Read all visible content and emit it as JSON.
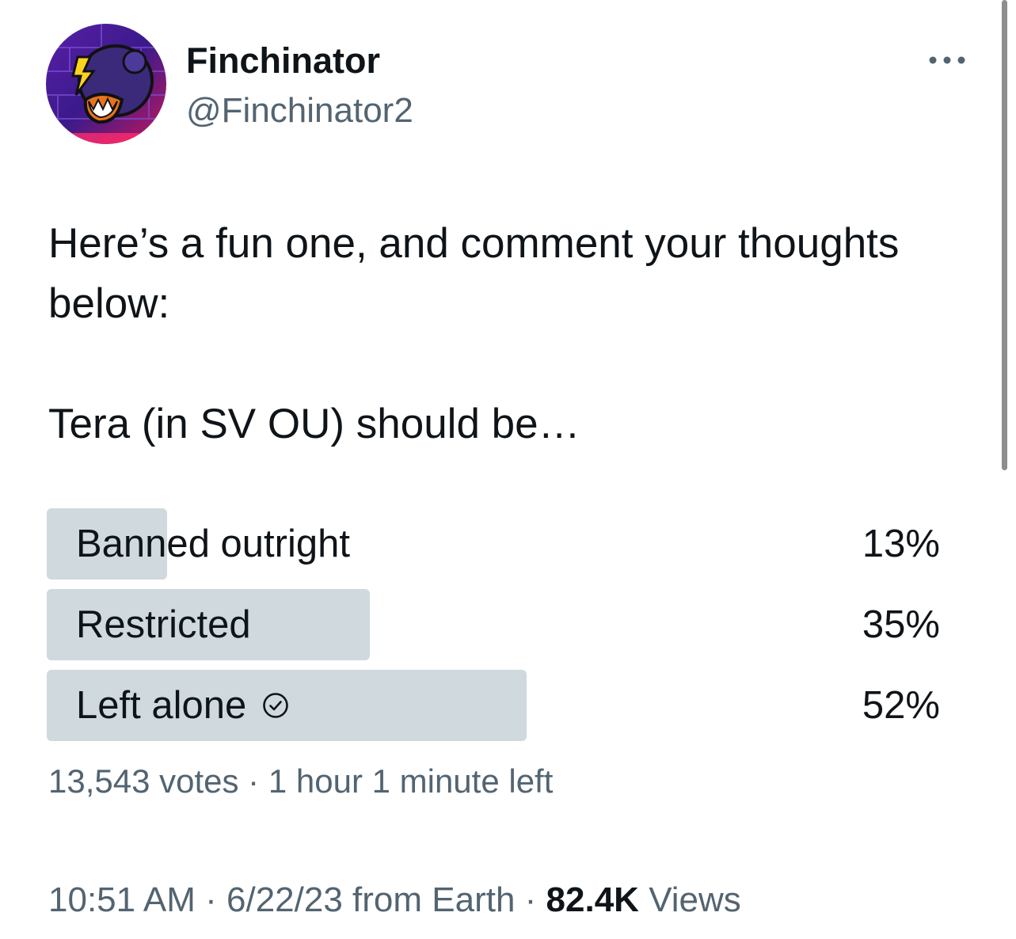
{
  "author": {
    "display_name": "Finchinator",
    "handle": "@Finchinator2",
    "avatar_icon": "cartoon-avatar-icon"
  },
  "more_icon": "more-dots-icon",
  "tweet": {
    "text": "Here’s a fun one, and comment your thoughts below:\n\nTera (in SV OU) should be…"
  },
  "poll": {
    "options": [
      {
        "label": "Banned outright",
        "percent": "13%",
        "fraction": 0.13
      },
      {
        "label": "Restricted",
        "percent": "35%",
        "fraction": 0.35
      },
      {
        "label": "Left alone",
        "percent": "52%",
        "fraction": 0.52,
        "selected_icon": "check-circle-icon"
      }
    ],
    "votes": "13,543 votes",
    "separator": " · ",
    "time_left": "1 hour 1 minute left"
  },
  "meta": {
    "time": "10:51 AM",
    "separator": " · ",
    "date": "6/22/23 from Earth",
    "views_count": "82.4K",
    "views_label": " Views"
  },
  "colors": {
    "text_primary": "#0f1419",
    "text_secondary": "#536471",
    "poll_bar": "#cfd9de"
  }
}
